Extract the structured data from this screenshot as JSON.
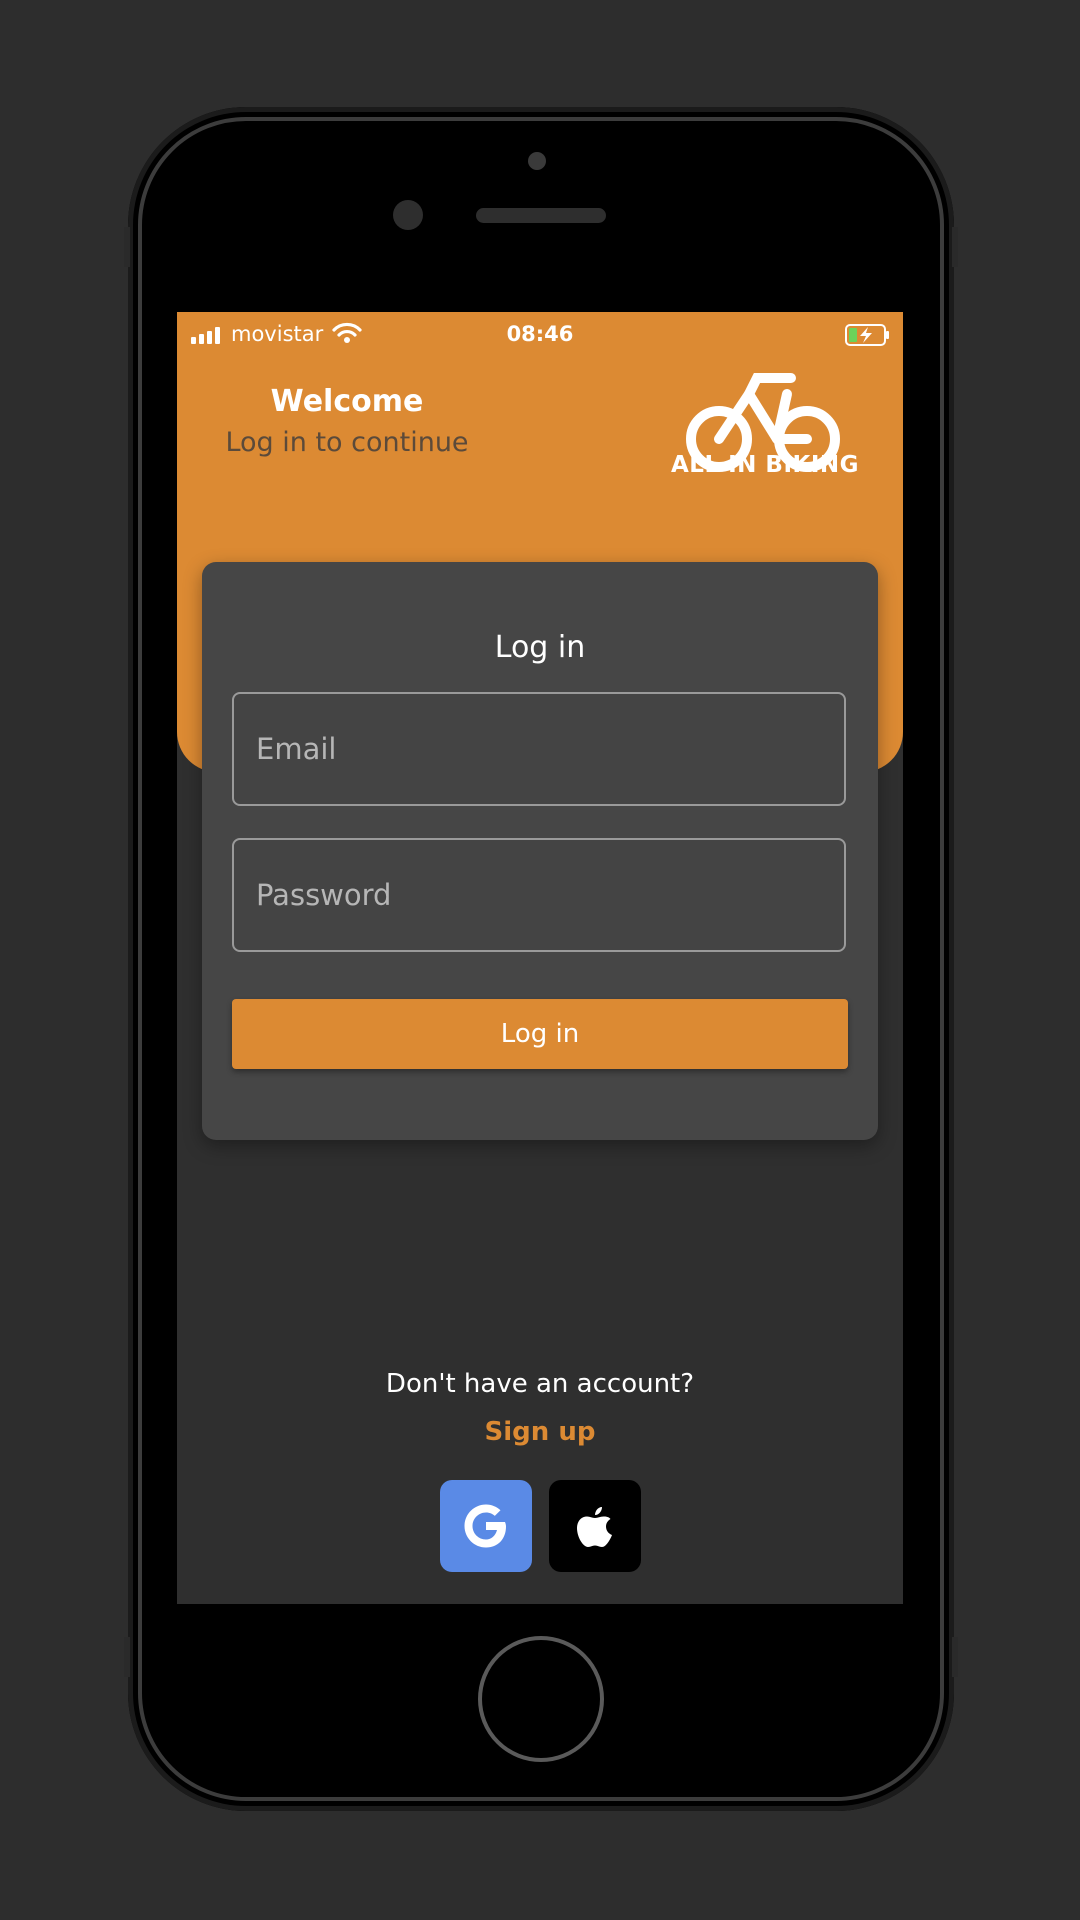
{
  "status_bar": {
    "carrier": "movistar",
    "time": "08:46",
    "icons": [
      "signal-icon",
      "wifi-icon",
      "battery-charging-icon"
    ]
  },
  "header": {
    "title": "Welcome",
    "subtitle": "Log in to continue",
    "logo_text": "ALL IN BIKING",
    "logo_icon": "bicycle-icon",
    "color": "#dc8a33"
  },
  "login_card": {
    "title": "Log in",
    "email_placeholder": "Email",
    "password_placeholder": "Password",
    "submit_label": "Log in"
  },
  "footer": {
    "no_account_text": "Don't have an account?",
    "signup_label": "Sign up",
    "social": [
      {
        "icon": "google-icon",
        "color": "#5a8ae6"
      },
      {
        "icon": "apple-icon",
        "color": "#000000"
      }
    ]
  },
  "colors": {
    "accent": "#dc8a33",
    "background": "#2f2f2f",
    "card": "#464646"
  }
}
